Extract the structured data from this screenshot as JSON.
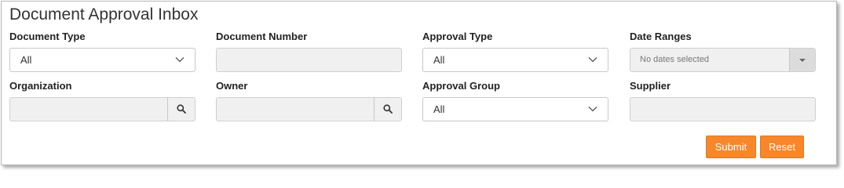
{
  "page_title": "Document Approval Inbox",
  "filters": {
    "document_type": {
      "label": "Document Type",
      "value": "All",
      "icon": "chevron-down-icon"
    },
    "document_number": {
      "label": "Document Number",
      "value": ""
    },
    "approval_type": {
      "label": "Approval Type",
      "value": "All",
      "icon": "chevron-down-icon"
    },
    "date_ranges": {
      "label": "Date Ranges",
      "value": "No dates selected",
      "icon": "caret-down-icon"
    },
    "organization": {
      "label": "Organization",
      "value": "",
      "icon": "search-icon"
    },
    "owner": {
      "label": "Owner",
      "value": "",
      "icon": "search-icon"
    },
    "approval_group": {
      "label": "Approval Group",
      "value": "All",
      "icon": "chevron-down-icon"
    },
    "supplier": {
      "label": "Supplier",
      "value": ""
    }
  },
  "actions": {
    "submit_label": "Submit",
    "reset_label": "Reset"
  },
  "colors": {
    "button_bg": "#f7872a",
    "button_text": "#ffffff",
    "disabled_field_bg": "#f0f0f0",
    "panel_border": "#b9b9b9"
  }
}
